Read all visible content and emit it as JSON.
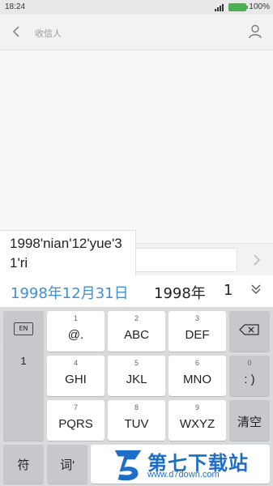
{
  "status_bar": {
    "time": "18:24",
    "battery_pct": "100%",
    "battery_color": "#4caf50"
  },
  "header": {
    "recipient_placeholder": "收信人",
    "back_icon": "chevron-left-icon",
    "contact_icon": "person-icon"
  },
  "compose": {
    "send_icon": "chevron-right-icon"
  },
  "pinyin_popup": {
    "text": "1998'nian'12'yue'31'ri"
  },
  "candidates": {
    "items": [
      "1998年12月31日",
      "1998年",
      "1"
    ],
    "highlight_color": "#3f8fd8"
  },
  "keyboard": {
    "en_label": "EN",
    "one_label": "1",
    "keys": [
      {
        "num": "1",
        "label": "@."
      },
      {
        "num": "2",
        "label": "ABC"
      },
      {
        "num": "3",
        "label": "DEF"
      },
      {
        "num": "4",
        "label": "GHI"
      },
      {
        "num": "5",
        "label": "JKL"
      },
      {
        "num": "6",
        "label": "MNO"
      },
      {
        "num": "0",
        "label": ": )"
      },
      {
        "num": "7",
        "label": "PQRS"
      },
      {
        "num": "8",
        "label": "TUV"
      },
      {
        "num": "9",
        "label": "WXYZ"
      }
    ],
    "clear_label": "清空",
    "symbol_label": "符",
    "word_label": "词'",
    "backspace_icon": "backspace-icon"
  },
  "watermark": {
    "text": "第七下载站",
    "url": "www.d7down.com"
  }
}
